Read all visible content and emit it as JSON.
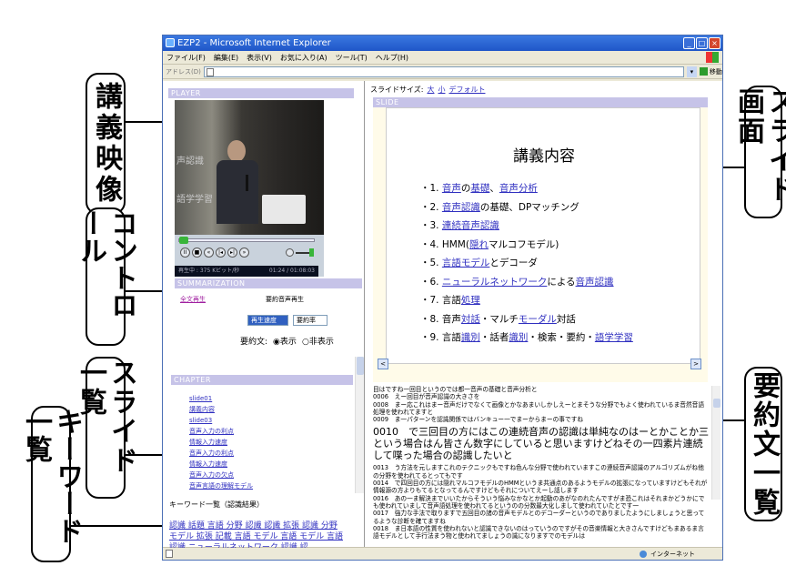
{
  "callouts": {
    "lecture_video": "講義映像",
    "controls": "コントロール",
    "slide_list": "スライド一覧",
    "keyword_list": "キーワード一覧",
    "slide_screen": "スライド画面",
    "summary_list": "要約文一覧"
  },
  "window": {
    "title": "EZP2 - Microsoft Internet Explorer",
    "menu": [
      "ファイル(F)",
      "編集(E)",
      "表示(V)",
      "お気に入り(A)",
      "ツール(T)",
      "ヘルプ(H)"
    ],
    "address_label": "アドレス(D)",
    "go_label": "移動",
    "status_zone": "インターネット"
  },
  "player": {
    "header": "PLAYER",
    "status_left": "再生中 : 375 Kビット/秒",
    "status_right": "01:24 / 01:08:03",
    "ghost_text_1": "声認識",
    "ghost_text_2": "語学学習"
  },
  "summarization": {
    "header": "SUMMARIZATION",
    "full_play": "全文再生",
    "summary_play": "要約音声再生",
    "select_mode": "再生速度",
    "select_rate": "要約率",
    "summary_label": "要約文:",
    "radio_show": "表示",
    "radio_hide": "非表示"
  },
  "chapter": {
    "header": "CHAPTER",
    "items": [
      "slide01",
      "講義内容",
      "slide03",
      "音声入力の利点",
      "情報入力速度",
      "音声入力の利点",
      "情報入力速度",
      "音声入力の欠点",
      "音声言語の理解モデル"
    ]
  },
  "keywords": {
    "title": "キーワード一覧（認識結果）",
    "items": "認識 話題 言語 分野 認識 認識 拡張 認識 分野 モデル 拡張 記載 言語 モデル 言語 モデル 言語 認識 ニューラルネットワーク 認識 認"
  },
  "slide": {
    "size_label": "スライドサイズ:",
    "size_large": "大",
    "size_small": "小",
    "size_default": "デフォルト",
    "header": "SLIDE",
    "title": "講義内容",
    "items": [
      "・1. 音声の基礎、音声分析",
      "・2. 音声認識の基礎、DPマッチング",
      "・3. 連続音声認識",
      "・4. HMM(隠れマルコフモデル)",
      "・5. 言語モデルとデコーダ",
      "・6. ニューラルネットワークによる音声認識",
      "・7. 言語処理",
      "・8. 音声対話・マルチモーダル対話",
      "・9. 言語識別・話者識別・検索・要約・語学学習"
    ],
    "prev": "<",
    "next": ">"
  },
  "summary_text": {
    "line1": "目はですね一回目というのでは都一音声の基礎と音声分析と",
    "line2": "0006　えー回目が音声認識の大きさを",
    "line3": "0008　まー応これはまー音声だけでなくて画像とかなあまいしかしえーとまそうな分野でもよく使われているま音然音語処理を使われてますと",
    "line4": "0009　ま一パターンを認識関係ではバンキュー一でまーからまーの事ですね",
    "big": "0010　で三回目の方にはこの連続音声の認識は単純なのはーとかことか三という場合はん皆さん数字にしていると思いますけどねその一四素片連続して喋った場合の認識したいと",
    "line5": "0013　う方法を元しますこれのテクニックもですね色んな分野で使われていますこの連続音声認識のアルゴリズムがね他の分野を使われてるとってもです",
    "line6": "0014　で四回目の方には隠れマルコフモデルのHMMというま共通点のあるようモデルの拡張になっていますけどもそれが情報源の方よりもてるとなってるんですけどもそれについてえーし話します",
    "line7": "0016　あの一ま解決までいいたからそういう悩みなかなとか起動のあがなのれたんですがま恐これはそれまかどうかにでも使われていまして音声語処理を使われてるというのの分数最大化しまして使われていたとです一",
    "line8": "0017　強力な手法で取りますで五回目の諸の音声モデルとのデコーダーというのでありましたようにしましょうと思ってるような診断を確てますね",
    "line9": "0018　ま日本語の性質を使われないと認識できないのはっていうのですがその音楽情報と大きさんですけどもまあるま言語モデルとして手行法まう物と使われてましょうの識になりますでのモデルは"
  }
}
